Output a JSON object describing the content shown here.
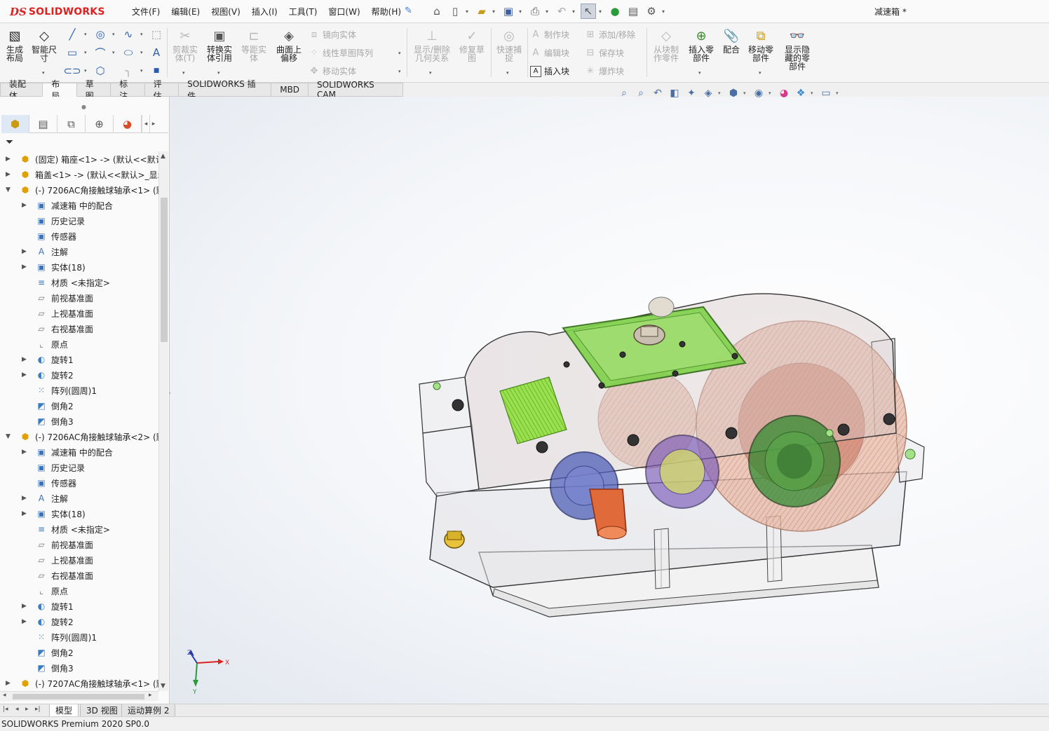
{
  "app": {
    "logo_prefix": "DS",
    "logo_name": "SOLIDWORKS",
    "document_title": "减速箱 *"
  },
  "menu": [
    "文件(F)",
    "编辑(E)",
    "视图(V)",
    "插入(I)",
    "工具(T)",
    "窗口(W)",
    "帮助(H)"
  ],
  "command_manager": {
    "generate_layout": "生成布局",
    "smart_dimension": "智能尺寸",
    "trim_entities": "剪裁实体(T)",
    "convert_entities": "转换实体引用",
    "offset_entities": "等距实体",
    "offset_on_surface": "曲面上偏移",
    "mirror_entities": "镜向实体",
    "linear_pattern": "线性草图阵列",
    "move_entities": "移动实体",
    "display_delete_relations": "显示/删除几何关系",
    "repair_sketch": "修复草图",
    "quick_snaps": "快速捕捉",
    "make_block": "制作块",
    "edit_block": "编辑块",
    "insert_block": "插入块",
    "add_remove": "添加/移除",
    "save_block": "保存块",
    "explode_block": "爆炸块",
    "make_part_from_block": "从块制作零件",
    "insert_component": "插入零部件",
    "mate": "配合",
    "move_component": "移动零部件",
    "show_hidden_components": "显示隐藏的零部件"
  },
  "tabs": [
    "装配体",
    "布局",
    "草图",
    "标注",
    "评估",
    "SOLIDWORKS 插件",
    "MBD",
    "SOLIDWORKS CAM"
  ],
  "active_tab": "布局",
  "feature_tree": [
    {
      "label": "(固定) 箱座<1> -> (默认<<默认",
      "type": "assembly",
      "level": 0,
      "expander": "▶"
    },
    {
      "label": "箱盖<1> -> (默认<<默认>_显示",
      "type": "assembly",
      "level": 0,
      "expander": "▶"
    },
    {
      "label": "(-) 7206AC角接触球轴承<1> (默",
      "type": "assembly",
      "level": 0,
      "expander": "▼"
    },
    {
      "label": "减速箱 中的配合",
      "type": "folder",
      "level": 1,
      "expander": "▶"
    },
    {
      "label": "历史记录",
      "type": "folder",
      "level": 1,
      "expander": ""
    },
    {
      "label": "传感器",
      "type": "folder",
      "level": 1,
      "expander": ""
    },
    {
      "label": "注解",
      "type": "annotation",
      "level": 1,
      "expander": "▶"
    },
    {
      "label": "实体(18)",
      "type": "folder",
      "level": 1,
      "expander": "▶"
    },
    {
      "label": "材质 <未指定>",
      "type": "material",
      "level": 1,
      "expander": ""
    },
    {
      "label": "前视基准面",
      "type": "plane",
      "level": 1,
      "expander": ""
    },
    {
      "label": "上视基准面",
      "type": "plane",
      "level": 1,
      "expander": ""
    },
    {
      "label": "右视基准面",
      "type": "plane",
      "level": 1,
      "expander": ""
    },
    {
      "label": "原点",
      "type": "origin",
      "level": 1,
      "expander": ""
    },
    {
      "label": "旋转1",
      "type": "revolve",
      "level": 1,
      "expander": "▶"
    },
    {
      "label": "旋转2",
      "type": "revolve",
      "level": 1,
      "expander": "▶"
    },
    {
      "label": "阵列(圆周)1",
      "type": "pattern",
      "level": 1,
      "expander": ""
    },
    {
      "label": "倒角2",
      "type": "chamfer",
      "level": 1,
      "expander": ""
    },
    {
      "label": "倒角3",
      "type": "chamfer",
      "level": 1,
      "expander": ""
    },
    {
      "label": "(-) 7206AC角接触球轴承<2> (默",
      "type": "assembly",
      "level": 0,
      "expander": "▼"
    },
    {
      "label": "减速箱 中的配合",
      "type": "folder",
      "level": 1,
      "expander": "▶"
    },
    {
      "label": "历史记录",
      "type": "folder",
      "level": 1,
      "expander": ""
    },
    {
      "label": "传感器",
      "type": "folder",
      "level": 1,
      "expander": ""
    },
    {
      "label": "注解",
      "type": "annotation",
      "level": 1,
      "expander": "▶"
    },
    {
      "label": "实体(18)",
      "type": "folder",
      "level": 1,
      "expander": "▶"
    },
    {
      "label": "材质 <未指定>",
      "type": "material",
      "level": 1,
      "expander": ""
    },
    {
      "label": "前视基准面",
      "type": "plane",
      "level": 1,
      "expander": ""
    },
    {
      "label": "上视基准面",
      "type": "plane",
      "level": 1,
      "expander": ""
    },
    {
      "label": "右视基准面",
      "type": "plane",
      "level": 1,
      "expander": ""
    },
    {
      "label": "原点",
      "type": "origin",
      "level": 1,
      "expander": ""
    },
    {
      "label": "旋转1",
      "type": "revolve",
      "level": 1,
      "expander": "▶"
    },
    {
      "label": "旋转2",
      "type": "revolve",
      "level": 1,
      "expander": "▶"
    },
    {
      "label": "阵列(圆周)1",
      "type": "pattern",
      "level": 1,
      "expander": ""
    },
    {
      "label": "倒角2",
      "type": "chamfer",
      "level": 1,
      "expander": ""
    },
    {
      "label": "倒角3",
      "type": "chamfer",
      "level": 1,
      "expander": ""
    },
    {
      "label": "(-) 7207AC角接触球轴承<1> (默",
      "type": "assembly",
      "level": 0,
      "expander": "▶"
    }
  ],
  "bottom_tabs": [
    "模型",
    "3D 视图",
    "运动算例 2"
  ],
  "active_bottom_tab": "模型",
  "status": "SOLIDWORKS Premium 2020 SP0.0",
  "triad": {
    "x": "X",
    "y": "Y",
    "z": "Z"
  },
  "colors": {
    "accent": "#3a7ccf",
    "logo_red": "#d22222",
    "gear_green": "#6fcf3a",
    "housing_red": "#b5543a"
  }
}
